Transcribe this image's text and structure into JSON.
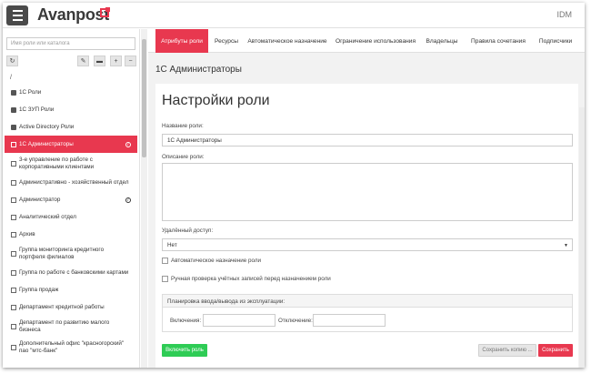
{
  "header": {
    "logo": "Avanpost",
    "product": "IDM"
  },
  "sidebar": {
    "search_placeholder": "Имя роли или каталога",
    "root": "/",
    "items": [
      {
        "label": "1С Роли",
        "type": "folder"
      },
      {
        "label": "1С ЗУП Роли",
        "type": "folder"
      },
      {
        "label": "Active Directory Роли",
        "type": "folder"
      },
      {
        "label": "1С Администраторы",
        "type": "file",
        "active": true,
        "blocked": true
      },
      {
        "label": "3-е управление по работе с корпоративными клиентами",
        "type": "file"
      },
      {
        "label": "Административно - хозяйственный отдел",
        "type": "file"
      },
      {
        "label": "Администратор",
        "type": "file",
        "blocked": true
      },
      {
        "label": "Аналитический отдел",
        "type": "file"
      },
      {
        "label": "Архив",
        "type": "file"
      },
      {
        "label": "Группа мониторинга кредитного портфеля филиалов",
        "type": "file"
      },
      {
        "label": "Группа по работе с банковскими картами",
        "type": "file"
      },
      {
        "label": "Группа продаж",
        "type": "file"
      },
      {
        "label": "Департамент кредитной работы",
        "type": "file"
      },
      {
        "label": "Департамент по развитию малого бизнеса",
        "type": "file"
      },
      {
        "label": "Дополнительный офис \"красногорский\" пао \"мтс-банк\"",
        "type": "file"
      }
    ]
  },
  "tabs": [
    {
      "label": "Атрибуты роли",
      "active": true
    },
    {
      "label": "Ресурсы"
    },
    {
      "label": "Автоматическое назначение"
    },
    {
      "label": "Ограничение использования"
    },
    {
      "label": "Владельцы"
    },
    {
      "label": "Правила сочетания"
    },
    {
      "label": "Подписчики"
    }
  ],
  "main": {
    "title": "1С Администраторы",
    "card_title": "Настройки роли",
    "name_label": "Название роли:",
    "name_value": "1С Администраторы",
    "desc_label": "Описание роли:",
    "desc_value": "",
    "remote_label": "Удалённый доступ:",
    "remote_value": "Нет",
    "auto_assign_label": "Автоматическое назначение роли",
    "manual_check_label": "Ручная проверка учётных записей перед назначением роли",
    "panel_title": "Планировка ввода/вывода из эксплуатации:",
    "enable_label": "Включения:",
    "disable_label": "Отключение:",
    "btn_enable": "Включить роль",
    "btn_save_copy": "Сохранить копию ...",
    "btn_save": "Сохранить"
  },
  "colors": {
    "accent": "#e8384f",
    "success": "#2ecc55",
    "header_dark": "#4a4a4a"
  }
}
